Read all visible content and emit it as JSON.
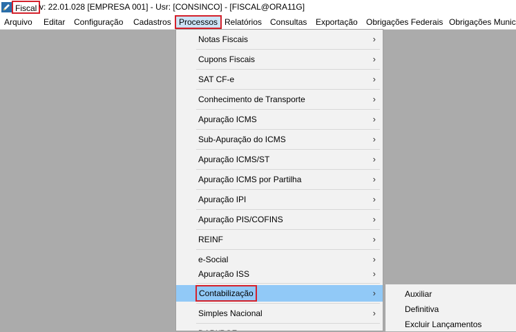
{
  "window": {
    "app_name": "Fiscal",
    "title_rest": "v: 22.01.028   [EMPRESA 001] - Usr: [CONSINCO] - [FISCAL@ORA11G]"
  },
  "menubar": {
    "items": [
      {
        "label": "Arquivo"
      },
      {
        "label": "Editar"
      },
      {
        "label": "Configuração"
      },
      {
        "label": "Cadastros"
      },
      {
        "label": "Processos"
      },
      {
        "label": "Relatórios"
      },
      {
        "label": "Consultas"
      },
      {
        "label": "Exportação"
      },
      {
        "label": "Obrigações Federais"
      },
      {
        "label": "Obrigações Munic"
      }
    ]
  },
  "dropdown": {
    "items": [
      {
        "label": "Notas Fiscais",
        "arrow": "›"
      },
      {
        "label": "Cupons Fiscais",
        "arrow": "›"
      },
      {
        "label": "SAT CF-e",
        "arrow": "›"
      },
      {
        "label": "Conhecimento de Transporte",
        "arrow": "›"
      },
      {
        "label": "Apuração ICMS",
        "arrow": "›"
      },
      {
        "label": "Sub-Apuração do ICMS",
        "arrow": "›"
      },
      {
        "label": "Apuração ICMS/ST",
        "arrow": "›"
      },
      {
        "label": "Apuração ICMS por Partilha",
        "arrow": "›"
      },
      {
        "label": "Apuração IPI",
        "arrow": "›"
      },
      {
        "label": "Apuração PIS/COFINS",
        "arrow": "›"
      },
      {
        "label": "REINF",
        "arrow": "›"
      },
      {
        "label": "e-Social",
        "arrow": "›"
      },
      {
        "label": "Apuração ISS",
        "arrow": "›"
      },
      {
        "label": "Contabilização",
        "arrow": "›"
      },
      {
        "label": "Simples Nacional",
        "arrow": "›"
      },
      {
        "label": "DAPI/PGF",
        "arrow": "›"
      }
    ]
  },
  "submenu": {
    "items": [
      {
        "label": "Auxiliar"
      },
      {
        "label": "Definitiva"
      },
      {
        "label": "Excluir Lançamentos"
      }
    ]
  }
}
